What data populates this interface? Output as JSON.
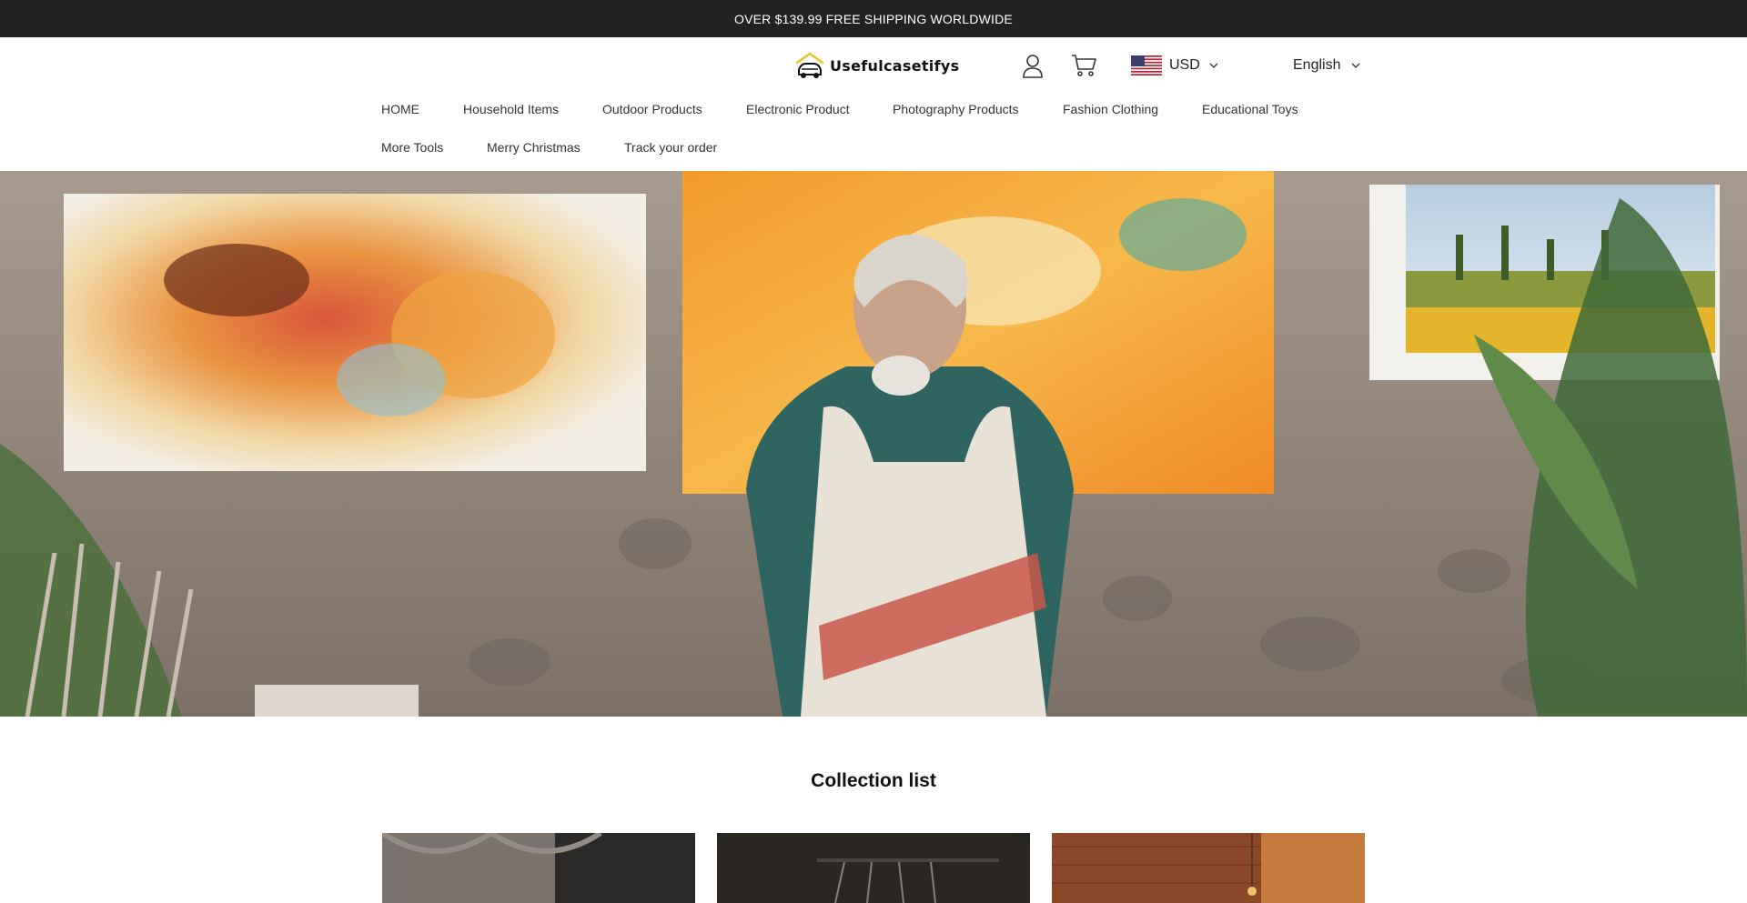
{
  "announcement": {
    "text": "OVER $139.99 FREE SHIPPING WORLDWIDE"
  },
  "header": {
    "logo_text": "Usefulcasetifys",
    "currency": {
      "code": "USD",
      "flag": "us-flag-icon"
    },
    "language": {
      "label": "English"
    }
  },
  "nav": {
    "items": [
      {
        "label": "HOME"
      },
      {
        "label": "Household Items"
      },
      {
        "label": "Outdoor Products"
      },
      {
        "label": "Electronic Product"
      },
      {
        "label": "Photography Products"
      },
      {
        "label": "Fashion Clothing"
      },
      {
        "label": "Educational Toys"
      },
      {
        "label": "More Tools"
      },
      {
        "label": "Merry Christmas"
      },
      {
        "label": "Track your order"
      }
    ]
  },
  "collection": {
    "title": "Collection list",
    "cards": [
      {
        "image": "knit-sweater-photo"
      },
      {
        "image": "clothing-rack-photo"
      },
      {
        "image": "brick-wall-interior-photo"
      }
    ]
  },
  "colors": {
    "announcement_bg": "#222222",
    "accent": "#222222"
  }
}
